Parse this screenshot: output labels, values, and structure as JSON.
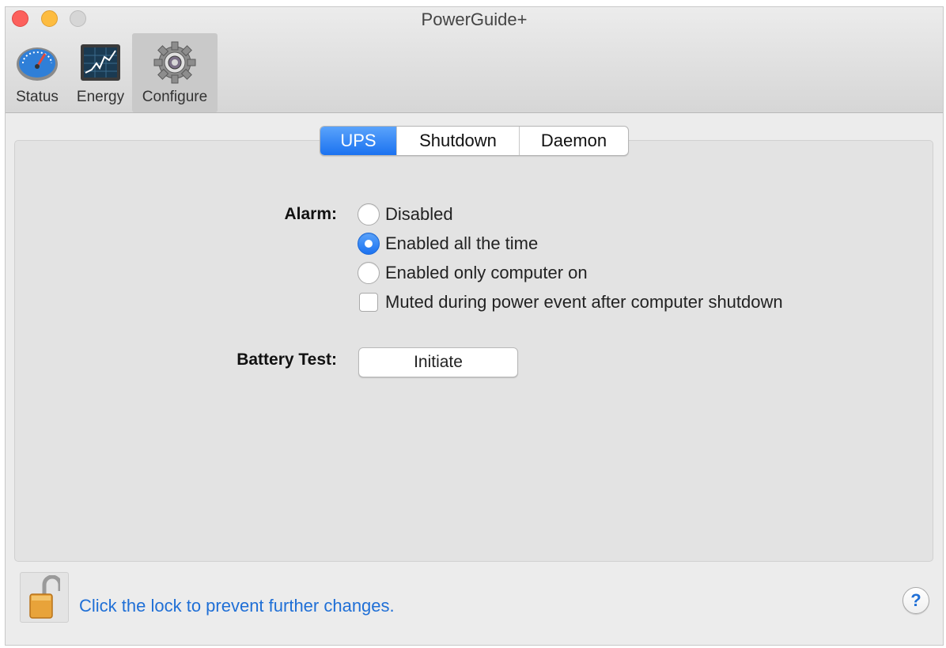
{
  "window": {
    "title": "PowerGuide+"
  },
  "toolbar": {
    "items": [
      {
        "label": "Status",
        "icon": "gauge-icon"
      },
      {
        "label": "Energy",
        "icon": "energy-graph-icon"
      },
      {
        "label": "Configure",
        "icon": "gear-icon",
        "selected": true
      }
    ]
  },
  "tabs": [
    {
      "label": "UPS",
      "active": true
    },
    {
      "label": "Shutdown",
      "active": false
    },
    {
      "label": "Daemon",
      "active": false
    }
  ],
  "alarm": {
    "label": "Alarm:",
    "options": [
      {
        "label": "Disabled",
        "type": "radio",
        "checked": false
      },
      {
        "label": "Enabled all the time",
        "type": "radio",
        "checked": true
      },
      {
        "label": "Enabled only computer on",
        "type": "radio",
        "checked": false
      },
      {
        "label": "Muted during power event after computer shutdown",
        "type": "checkbox",
        "checked": false
      }
    ]
  },
  "battery_test": {
    "label": "Battery Test:",
    "button_label": "Initiate"
  },
  "footer": {
    "lock_text": "Click the lock to prevent further changes.",
    "lock_icon": "unlocked-padlock-icon",
    "help_label": "?"
  },
  "colors": {
    "accent": "#1b72f0",
    "link": "#1f6fd6"
  }
}
